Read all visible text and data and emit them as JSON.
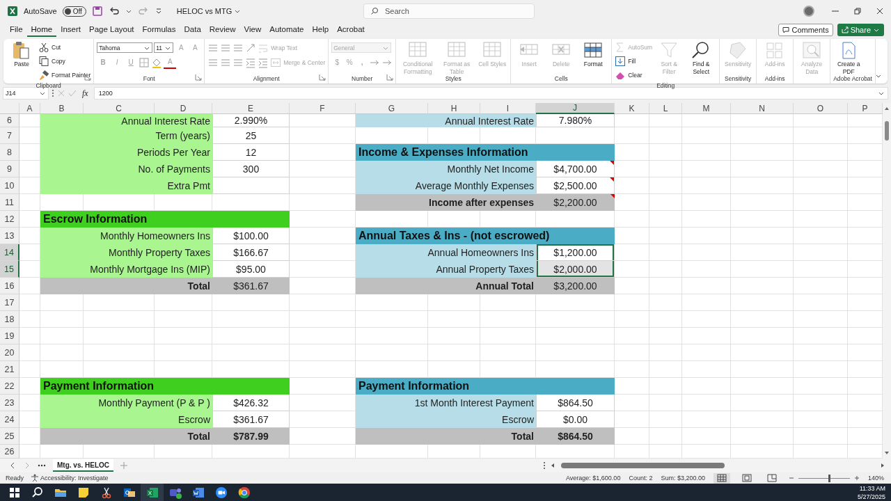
{
  "title_bar": {
    "autosave_label": "AutoSave",
    "autosave": {
      "on": false,
      "label": "Off"
    },
    "document_title": "HELOC vs MTG",
    "search": {
      "placeholder": "Search"
    }
  },
  "menu": {
    "tabs": [
      {
        "label": "File",
        "selected": false
      },
      {
        "label": "Home",
        "selected": true
      },
      {
        "label": "Insert",
        "selected": false
      },
      {
        "label": "Page Layout",
        "selected": false
      },
      {
        "label": "Formulas",
        "selected": false
      },
      {
        "label": "Data",
        "selected": false
      },
      {
        "label": "Review",
        "selected": false
      },
      {
        "label": "View",
        "selected": false
      },
      {
        "label": "Automate",
        "selected": false
      },
      {
        "label": "Help",
        "selected": false
      },
      {
        "label": "Acrobat",
        "selected": false
      }
    ],
    "comments": "Comments",
    "share": "Share"
  },
  "ribbon": {
    "groups": [
      {
        "label": "Clipboard",
        "kind": "clipboard",
        "buttons": [
          {
            "label": "Paste",
            "disabled": false
          },
          {
            "label": "Cut",
            "disabled": false
          },
          {
            "label": "Copy",
            "disabled": false
          },
          {
            "label": "Format Painter",
            "disabled": false
          }
        ]
      },
      {
        "label": "Font",
        "kind": "font",
        "fields": [
          "Tahoma",
          "11"
        ],
        "buttons": [
          {
            "label": "A",
            "disabled": true
          },
          {
            "label": "A",
            "disabled": true
          },
          {
            "label": "B",
            "disabled": true
          },
          {
            "label": "I",
            "disabled": true
          },
          {
            "label": "U",
            "disabled": true
          },
          {
            "label": "A",
            "disabled": true
          }
        ]
      },
      {
        "label": "Alignment",
        "kind": "alignment",
        "buttons": [
          {
            "label": "Wrap Text",
            "disabled": true
          },
          {
            "label": "Merge & Center",
            "disabled": true
          }
        ]
      },
      {
        "label": "Number",
        "kind": "number",
        "fields": [
          "General"
        ],
        "buttons": [
          {
            "label": "$",
            "disabled": true
          },
          {
            "label": "%",
            "disabled": true
          },
          {
            "label": ",",
            "disabled": true
          }
        ]
      },
      {
        "label": "Styles",
        "kind": "large",
        "buttons": [
          {
            "label": "Conditional Formatting",
            "disabled": true
          },
          {
            "label": "Format as Table",
            "disabled": true
          },
          {
            "label": "Cell Styles",
            "disabled": true
          }
        ]
      },
      {
        "label": "Cells",
        "kind": "large",
        "buttons": [
          {
            "label": "Insert",
            "disabled": true
          },
          {
            "label": "Delete",
            "disabled": true
          },
          {
            "label": "Format",
            "disabled": false
          }
        ]
      },
      {
        "label": "Editing",
        "kind": "editing",
        "buttons": [
          {
            "label": "AutoSum",
            "disabled": true
          },
          {
            "label": "Fill",
            "disabled": false
          },
          {
            "label": "Clear",
            "disabled": false
          },
          {
            "label": "Sort & Filter",
            "disabled": true
          },
          {
            "label": "Find & Select",
            "disabled": false
          }
        ]
      },
      {
        "label": "Sensitivity",
        "kind": "large",
        "buttons": [
          {
            "label": "Sensitivity",
            "disabled": true
          }
        ]
      },
      {
        "label": "Add-ins",
        "kind": "large",
        "buttons": [
          {
            "label": "Add-ins",
            "disabled": true
          }
        ]
      },
      {
        "kind": "large",
        "buttons": [
          {
            "label": "Analyze Data",
            "disabled": true
          }
        ]
      },
      {
        "label": "Adobe Acrobat",
        "kind": "large",
        "buttons": [
          {
            "label": "Create a PDF",
            "disabled": false
          }
        ]
      }
    ]
  },
  "formula_bar": {
    "name_box": "J14",
    "fx": "fx",
    "value": "1200"
  },
  "sheet": {
    "columns": [
      {
        "label": "A",
        "selected": false
      },
      {
        "label": "B",
        "selected": false
      },
      {
        "label": "C",
        "selected": false
      },
      {
        "label": "D",
        "selected": false
      },
      {
        "label": "E",
        "selected": false
      },
      {
        "label": "F",
        "selected": false
      },
      {
        "label": "G",
        "selected": false
      },
      {
        "label": "H",
        "selected": false
      },
      {
        "label": "I",
        "selected": false
      },
      {
        "label": "J",
        "selected": true
      },
      {
        "label": "K",
        "selected": false
      },
      {
        "label": "L",
        "selected": false
      },
      {
        "label": "M",
        "selected": false
      },
      {
        "label": "N",
        "selected": false
      },
      {
        "label": "O",
        "selected": false
      },
      {
        "label": "P",
        "selected": false
      }
    ],
    "rows": [
      {
        "header": "6",
        "selected": false,
        "left": {
          "kind": "field",
          "label": "Annual Interest Rate",
          "value": "2.990%"
        },
        "right": {
          "kind": "field",
          "label": "Annual Interest Rate",
          "value": "7.980%"
        }
      },
      {
        "header": "7",
        "selected": false,
        "left": {
          "kind": "field",
          "label": "Term (years)",
          "value": "25"
        }
      },
      {
        "header": "8",
        "selected": false,
        "left": {
          "kind": "field",
          "label": "Periods Per Year",
          "value": "12"
        },
        "right": {
          "kind": "section",
          "label": "Income & Expenses Information"
        }
      },
      {
        "header": "9",
        "selected": false,
        "left": {
          "kind": "field",
          "label": "No. of Payments",
          "value": "300"
        },
        "right": {
          "kind": "field",
          "label": "Monthly Net Income",
          "value": "$4,700.00",
          "comment": true
        }
      },
      {
        "header": "10",
        "selected": false,
        "left": {
          "kind": "field",
          "label": "Extra Pmt"
        },
        "right": {
          "kind": "field",
          "label": "Average Monthly Expenses",
          "value": "$2,500.00",
          "comment": true
        }
      },
      {
        "header": "11",
        "selected": false,
        "right": {
          "kind": "total",
          "label": "Income after expenses",
          "value": "$2,200.00",
          "comment": true
        }
      },
      {
        "header": "12",
        "selected": false,
        "left": {
          "kind": "section",
          "label": "Escrow Information"
        }
      },
      {
        "header": "13",
        "selected": false,
        "left": {
          "kind": "field",
          "label": "Monthly Homeowners Ins",
          "value": "$100.00"
        },
        "right": {
          "kind": "section",
          "label": "Annual Taxes & Ins -  (not escrowed)"
        }
      },
      {
        "header": "14",
        "selected": true,
        "left": {
          "kind": "field",
          "label": "Monthly Property Taxes",
          "value": "$166.67"
        },
        "right": {
          "kind": "field",
          "label": "Annual Homeowners Ins",
          "value": "$1,200.00",
          "selected": true,
          "active": true
        }
      },
      {
        "header": "15",
        "selected": true,
        "left": {
          "kind": "field",
          "label": "Monthly Mortgage Ins (MIP)",
          "value": "$95.00"
        },
        "right": {
          "kind": "field",
          "label": "Annual Property Taxes",
          "value": "$2,000.00",
          "selected": true,
          "active": false
        }
      },
      {
        "header": "16",
        "selected": false,
        "left": {
          "kind": "total",
          "label": "Total",
          "value": "$361.67"
        },
        "right": {
          "kind": "total",
          "label": "Annual Total",
          "value": "$3,200.00"
        }
      },
      {
        "header": "17",
        "selected": false
      },
      {
        "header": "18",
        "selected": false
      },
      {
        "header": "19",
        "selected": false
      },
      {
        "header": "20",
        "selected": false
      },
      {
        "header": "21",
        "selected": false
      },
      {
        "header": "22",
        "selected": false,
        "left": {
          "kind": "section",
          "label": "Payment Information"
        },
        "right": {
          "kind": "section",
          "label": "Payment Information"
        }
      },
      {
        "header": "23",
        "selected": false,
        "left": {
          "kind": "field",
          "label": "Monthly Payment (P & P )",
          "value": "$426.32"
        },
        "right": {
          "kind": "field",
          "label": "1st Month Interest Payment",
          "value": "$864.50"
        }
      },
      {
        "header": "24",
        "selected": false,
        "left": {
          "kind": "field",
          "label": "Escrow",
          "value": "$361.67"
        },
        "right": {
          "kind": "field",
          "label": "Escrow",
          "value": "$0.00"
        }
      },
      {
        "header": "25",
        "selected": false,
        "left": {
          "kind": "grand",
          "label": "Total",
          "value": "$787.99"
        },
        "right": {
          "kind": "grand",
          "label": "Total",
          "value": "$864.50"
        }
      },
      {
        "header": "26",
        "selected": false
      }
    ]
  },
  "sheet_tabs": {
    "tabs": [
      {
        "label": "Mtg. vs. HELOC",
        "selected": true
      }
    ]
  },
  "status_bar": {
    "mode": "Ready",
    "accessibility": "Accessibility: Investigate",
    "average": "Average: $1,600.00",
    "count": "Count: 2",
    "sum": "Sum: $3,200.00",
    "views": [
      {
        "selected": true
      },
      {
        "selected": false
      },
      {
        "selected": false
      }
    ],
    "zoom": {
      "level": 0.59,
      "label": "140%"
    }
  },
  "taskbar": {
    "apps": [
      {
        "selected": false
      },
      {
        "selected": false
      },
      {
        "selected": false
      },
      {
        "selected": false
      },
      {
        "selected": true
      },
      {
        "selected": false
      },
      {
        "selected": false
      },
      {
        "selected": false
      },
      {
        "selected": false
      }
    ],
    "time": "11:33 AM",
    "date": "5/27/2025"
  }
}
